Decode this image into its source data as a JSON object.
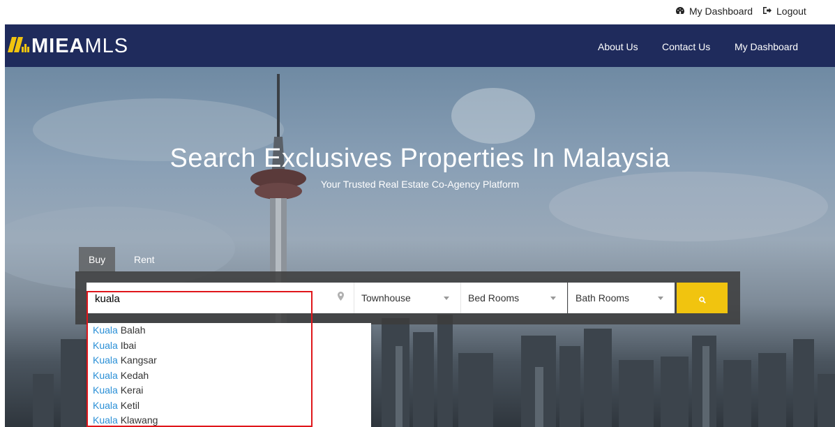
{
  "utility": {
    "dashboard_label": "My Dashboard",
    "logout_label": "Logout"
  },
  "brand": {
    "bold": "MIEA",
    "light": "MLS",
    "accent_color": "#f1c40f",
    "nav_color": "#1f2b5c"
  },
  "nav": {
    "about": "About Us",
    "contact": "Contact Us",
    "dashboard": "My Dashboard"
  },
  "hero": {
    "title": "Search Exclusives Properties In Malaysia",
    "subtitle": "Your Trusted Real Estate Co-Agency Platform"
  },
  "tabs": [
    {
      "label": "Buy",
      "active": true
    },
    {
      "label": "Rent",
      "active": false
    }
  ],
  "search": {
    "location_value": "kuala",
    "property_type": "Townhouse",
    "bedrooms": "Bed Rooms",
    "bathrooms": "Bath Rooms"
  },
  "suggestions": [
    {
      "match": "Kuala",
      "rest": " Balah"
    },
    {
      "match": "Kuala",
      "rest": " Ibai"
    },
    {
      "match": "Kuala",
      "rest": " Kangsar"
    },
    {
      "match": "Kuala",
      "rest": " Kedah"
    },
    {
      "match": "Kuala",
      "rest": " Kerai"
    },
    {
      "match": "Kuala",
      "rest": " Ketil"
    },
    {
      "match": "Kuala",
      "rest": " Klawang"
    }
  ]
}
